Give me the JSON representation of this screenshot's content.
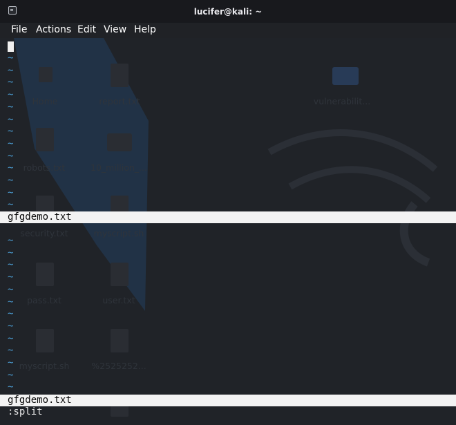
{
  "window": {
    "title": "lucifer@kali: ~"
  },
  "menu": [
    "File",
    "Actions",
    "Edit",
    "View",
    "Help"
  ],
  "editor": {
    "tilde": "~",
    "top_file": "gfgdemo.txt",
    "bottom_file": "gfgdemo.txt",
    "command": ":split"
  },
  "desktop_icons": [
    "Home",
    "report.txt",
    "vulnerabilit...",
    "robots.txt",
    "10_million_...",
    "security.txt",
    "myscript.sh",
    "pass.txt",
    "user.txt",
    "myscript.sh",
    "%2525252..."
  ],
  "colors": {
    "tilde": "#4c9fd6",
    "statusbar_bg": "#f3f3f3",
    "terminal_bg": "#202328"
  }
}
